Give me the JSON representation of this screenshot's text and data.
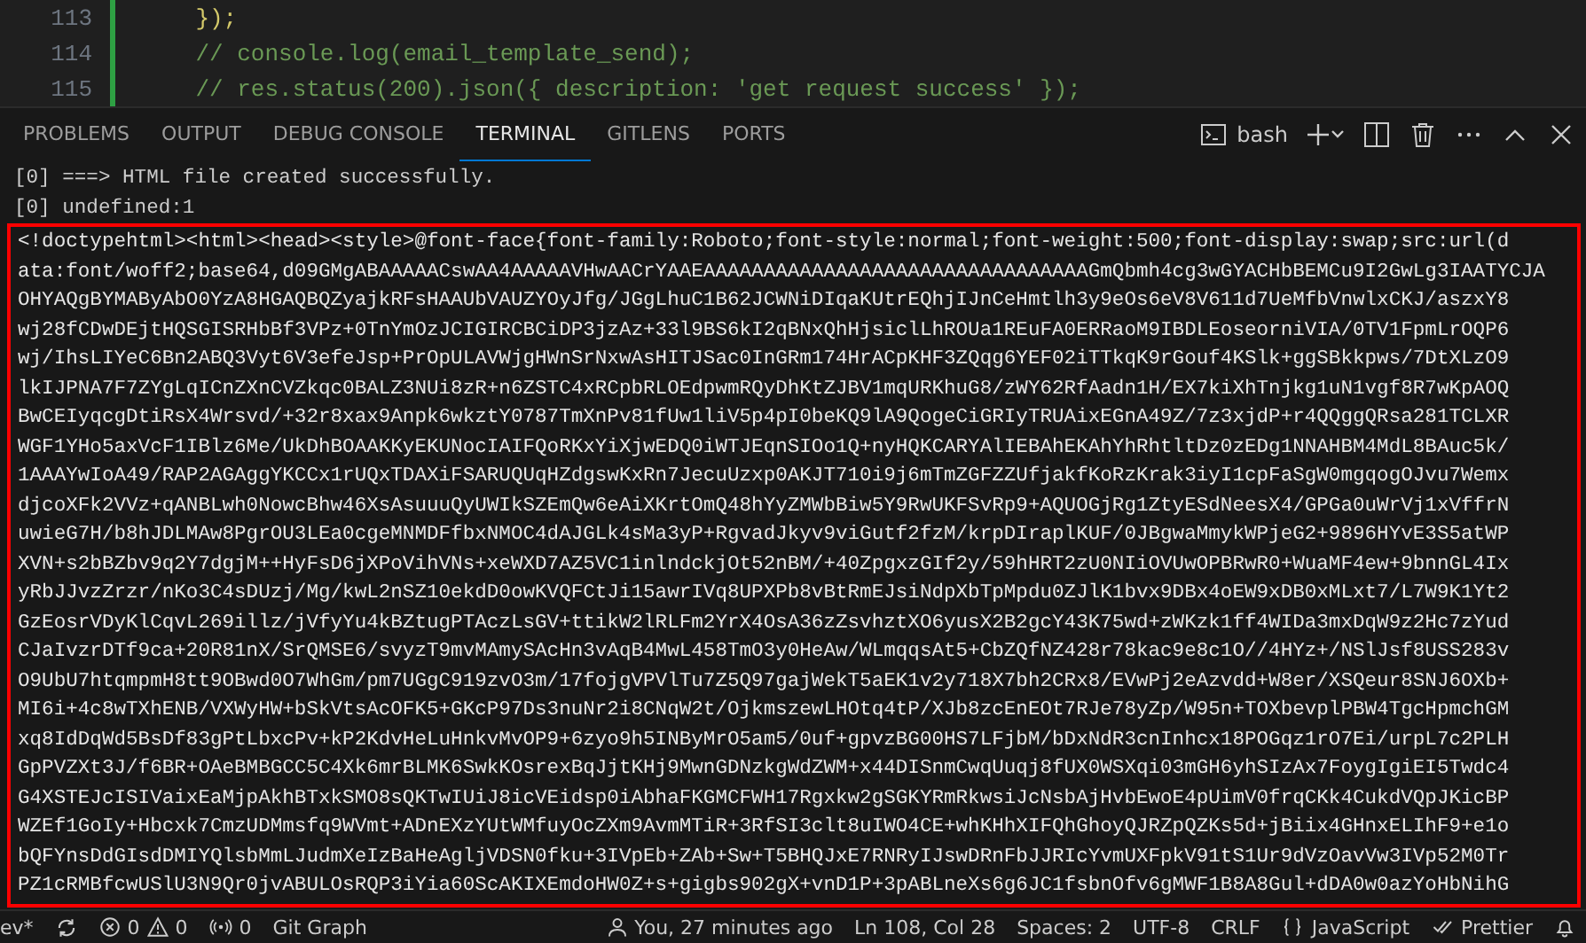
{
  "editor": {
    "lines": [
      {
        "number": "113",
        "kind": "code",
        "text": "    });"
      },
      {
        "number": "114",
        "kind": "comment",
        "text": "    // console.log(email_template_send);"
      },
      {
        "number": "115",
        "kind": "comment",
        "text": "    // res.status(200).json({ description: 'get request success' });"
      }
    ]
  },
  "panel": {
    "tabs": [
      {
        "label": "PROBLEMS",
        "selected": false
      },
      {
        "label": "OUTPUT",
        "selected": false
      },
      {
        "label": "DEBUG CONSOLE",
        "selected": false
      },
      {
        "label": "TERMINAL",
        "selected": true
      },
      {
        "label": "GITLENS",
        "selected": false
      },
      {
        "label": "PORTS",
        "selected": false
      }
    ],
    "terminal_profile": "bash"
  },
  "terminal": {
    "output": [
      "[0] ===> HTML file created successfully.",
      "[0] undefined:1"
    ],
    "highlighted_output": [
      "<!doctypehtml><html><head><style>@font-face{font-family:Roboto;font-style:normal;font-weight:500;font-display:swap;src:url(d",
      "ata:font/woff2;base64,d09GMgABAAAAACswAA4AAAAAVHwAACrYAAEAAAAAAAAAAAAAAAAAAAAAAAAAAAAAAAAGmQbmh4cg3wGYACHbBEMCu9I2GwLg3IAATYCJA",
      "OHYAQgBYMAByAbO0YzA8HGAQBQZyajkRFsHAAUbVAUZYOyJfg/JGgLhuC1B62JCWNiDIqaKUtrEQhjIJnCeHmtlh3y9eOs6eV8V611d7UeMfbVnwlxCKJ/aszxY8",
      "wj28fCDwDEjtHQSGISRHbBf3VPz+0TnYmOzJCIGIRCBCiDP3jzAz+33l9BS6kI2qBNxQhHjsiclLhROUa1REuFA0ERRaoM9IBDLEoseorniVIA/0TV1FpmLrOQP6",
      "wj/IhsLIYeC6Bn2ABQ3Vyt6V3efeJsp+PrOpULAVWjgHWnSrNxwAsHITJSac0InGRm174HrACpKHF3ZQqg6YEF02iTTkqK9rGouf4KSlk+ggSBkkpws/7DtXLzO9",
      "lkIJPNA7F7ZYgLqICnZXnCVZkqc0BALZ3NUi8zR+n6ZSTC4xRCpbRLOEdpwmRQyDhKtZJBV1mqURKhuG8/zWY62RfAadn1H/EX7kiXhTnjkg1uN1vgf8R7wKpAOQ",
      "BwCEIyqcgDtiRsX4Wrsvd/+32r8xax9Anpk6wkztY0787TmXnPv81fUw1liV5p4pI0beKQ9lA9QogeCiGRIyTRUAixEGnA49Z/7z3xjdP+r4QQggQRsa281TCLXR",
      "WGF1YHo5axVcF1IBlz6Me/UkDhBOAAKKyEKUNocIAIFQoRKxYiXjwEDQ0iWTJEqnSIOo1Q+nyHQKCARYAlIEBAhEKAhYhRhtltDz0zEDg1NNAHBM4MdL8BAuc5k/",
      "1AAAYwIoA49/RAP2AGAggYKCCx1rUQxTDAXiFSARUQUqHZdgswKxRn7JecuUzxp0AKJT710i9j6mTmZGFZZUfjakfKoRzKrak3iyI1cpFaSgW0mgqogOJvu7Wemx",
      "djcoXFk2VVz+qANBLwh0NowcBhw46XsAsuuuQyUWIkSZEmQw6eAiXKrtOmQ48hYyZMWbBiw5Y9RwUKFSvRp9+AQUOGjRg1ZtyESdNeesX4/GPGa0uWrVj1xVffrN",
      "uwieG7H/b8hJDLMAw8PgrOU3LEa0cgeMNMDFfbxNMOC4dAJGLk4sMa3yP+RgvadJkyv9viGutf2fzM/krpDIraplKUF/0JBgwaMmykWPjeG2+9896HYvE3S5atWP",
      "XVN+s2bBZbv9q2Y7dgjM++HyFsD6jXPoVihVNs+xeWXD7AZ5VC1inlndckjOt52nBM/+40ZpgxzGIf2y/59hHRT2zU0NIiOVUwOPBRwR0+WuaMF4ew+9bnnGL4Ix",
      "yRbJJvzZrzr/nKo3C4sDUzj/Mg/kwL2nSZ10ekdD0owKVQFCtJi15awrIVq8UPXPb8vBtRmEJsiNdpXbTpMpdu0ZJlK1bvx9DBx4oEW9xDB0xMLxt7/L7W9K1Yt2",
      "GzEosrVDyKlCqvL269illz/jVfyYu4kBZtugPTAczLsGV+ttikW2lRLFm2YrX4OsA36zZsvhztXO6yusX2B2gcY43K75wd+zWKzk1ff4WIDa3mxDqW9z2Hc7zYud",
      "CJaIvzrDTf9ca+20R81nX/SrQMSE6/svyzT9mvMAmySAcHn3vAqB4MwL458TmO3y0HeAw/WLmqqsAt5+CbZQfNZ428r78kac9e8c1O//4HYz+/NSlJsf8USS283v",
      "O9UbU7htqmpmH8tt9OBwd0O7WhGm/pm7UGgC919zvO3m/17fojgVPVlTu7Z5Q97gajWekT5aEK1v2y718X7bh2CRx8/EVwPj2eAzvdd+W8er/XSQeur8SNJ6OXb+",
      "MI6i+4c8wTXhENB/VXWyHW+bSkVtsAcOFK5+GKcP97Ds3nuNr2i8CNqW2t/OjkmszewLHOtq4tP/XJb8zcEnEOt7RJe78yZp/W95n+TOXbevplPBW4TgcHpmchGM",
      "xq8IdDqWd5BsDf83gPtLbxcPv+kP2KdvHeLuHnkvMvOP9+6zyo9h5INByMrO5am5/0uf+gpvzBG00HS7LFjbM/bDxNdR3cnInhcx18POGqz1rO7Ei/urpL7c2PLH",
      "GpPVZXt3J/f6BR+OAeBMBGCC5C4Xk6mrBLMK6SwkKOsrexBqJjtKHj9MwnGDNzkgWdZWM+x44DISnmCwqUuqj8fUX0WSXqi03mGH6yhSIzAx7FoygIgiEI5Twdc4",
      "G4XSTEJcISIVaixEaMjpAkhBTxkSMO8sQKTwIUiJ8icVEidsp0iAbhaFKGMCFWH17Rgxkw2gSGKYRmRkwsiJcNsbAjHvbEwoE4pUimV0frqCKk4CukdVQpJKicBP",
      "WZEf1GoIy+Hbcxk7CmzUDMmsfq9WVmt+ADnEXzYUtWMfuyOcZXm9AvmMTiR+3RfSI3clt8uIWO4CE+whKHhXIFQhGhoyQJRZpQZKs5d+jBiix4GHnxELIhF9+e1o",
      "bQFYnsDdGIsdDMIYQlsbMmLJudmXeIzBaHeAgljVDSN0fku+3IVpEb+ZAb+Sw+T5BHQJxE7RNRyIJswDRnFbJJRIcYvmUXFpkV91tS1Ur9dVzOavVw3IVp52M0Tr",
      "PZ1cRMBfcwUSlU3N9Qr0jvABULOsRQP3iYia60ScAKIXEmdoHW0Z+s+gigbs902gX+vnD1P+3pABLneXs6g6JC1fsbnOfv6gMWF1B8A8Gul+dDA0w0azYoHbNihG"
    ]
  },
  "status_bar": {
    "left": [
      {
        "kind": "branch",
        "text": "ev*"
      },
      {
        "kind": "sync"
      },
      {
        "kind": "problems",
        "errors": "0",
        "warnings": "0"
      },
      {
        "kind": "ports",
        "text": "0"
      },
      {
        "kind": "plain",
        "text": "Git Graph"
      }
    ],
    "right": [
      {
        "kind": "blame",
        "text": "You, 27 minutes ago"
      },
      {
        "kind": "plain",
        "text": "Ln 108, Col 28"
      },
      {
        "kind": "plain",
        "text": "Spaces: 2"
      },
      {
        "kind": "plain",
        "text": "UTF-8"
      },
      {
        "kind": "plain",
        "text": "CRLF"
      },
      {
        "kind": "language",
        "text": "JavaScript"
      },
      {
        "kind": "prettier",
        "text": "Prettier"
      },
      {
        "kind": "bell"
      }
    ]
  }
}
